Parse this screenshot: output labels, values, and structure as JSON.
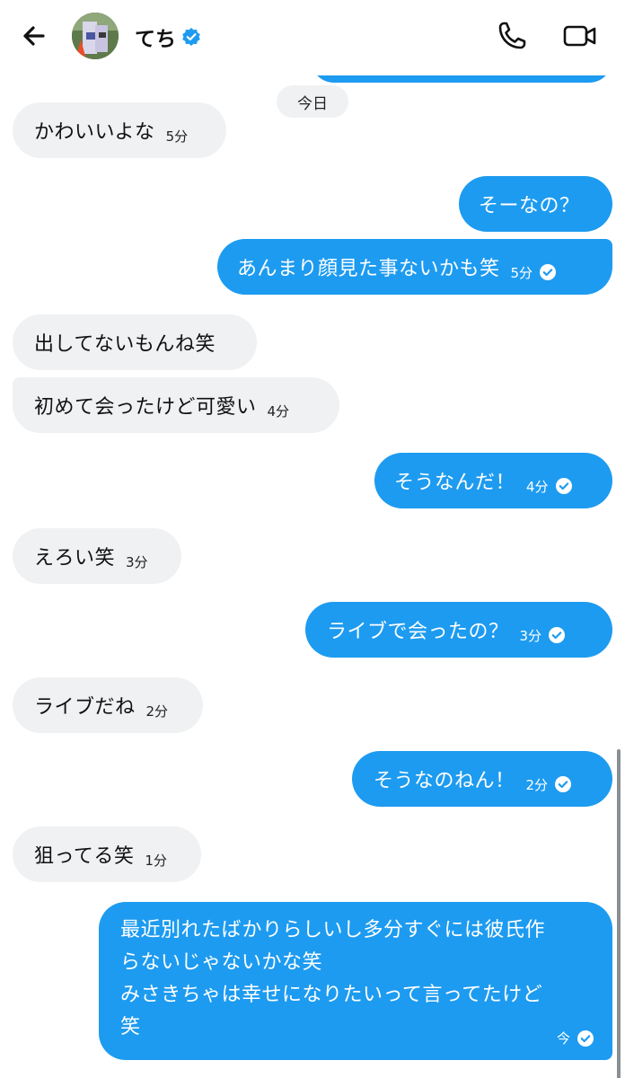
{
  "header": {
    "contact_name": "てち",
    "verified": true,
    "icons": [
      "back-arrow-icon",
      "verified-badge-icon",
      "phone-icon",
      "video-camera-icon"
    ]
  },
  "date_divider": "今日",
  "messages": [
    {
      "side": "in",
      "text": "かわいいよな",
      "time": "5分"
    },
    {
      "side": "out",
      "text": "そーなの？",
      "time": ""
    },
    {
      "side": "out",
      "text": "あんまり顔見た事ないかも笑",
      "time": "5分"
    },
    {
      "side": "in",
      "text": "出してないもんね笑",
      "time": ""
    },
    {
      "side": "in",
      "text": "初めて会ったけど可愛い",
      "time": "4分"
    },
    {
      "side": "out",
      "text": "そうなんだ！",
      "time": "4分"
    },
    {
      "side": "in",
      "text": "えろい笑",
      "time": "3分"
    },
    {
      "side": "out",
      "text": "ライブで会ったの？",
      "time": "3分"
    },
    {
      "side": "in",
      "text": "ライブだね",
      "time": "2分"
    },
    {
      "side": "out",
      "text": "そうなのねん！",
      "time": "2分"
    },
    {
      "side": "in",
      "text": "狙ってる笑",
      "time": "1分"
    }
  ],
  "last_message": {
    "side": "out",
    "lines": [
      "最近別れたばかりらしいし多分すぐには彼氏作",
      "らないじゃないかな笑",
      "みさきちゃは幸せになりたいって言ってたけど",
      "笑"
    ],
    "time": "今"
  },
  "colors": {
    "outgoing_bubble": "#1d9bf0",
    "incoming_bubble": "#eff1f3",
    "verified_badge": "#1d9bf0"
  }
}
